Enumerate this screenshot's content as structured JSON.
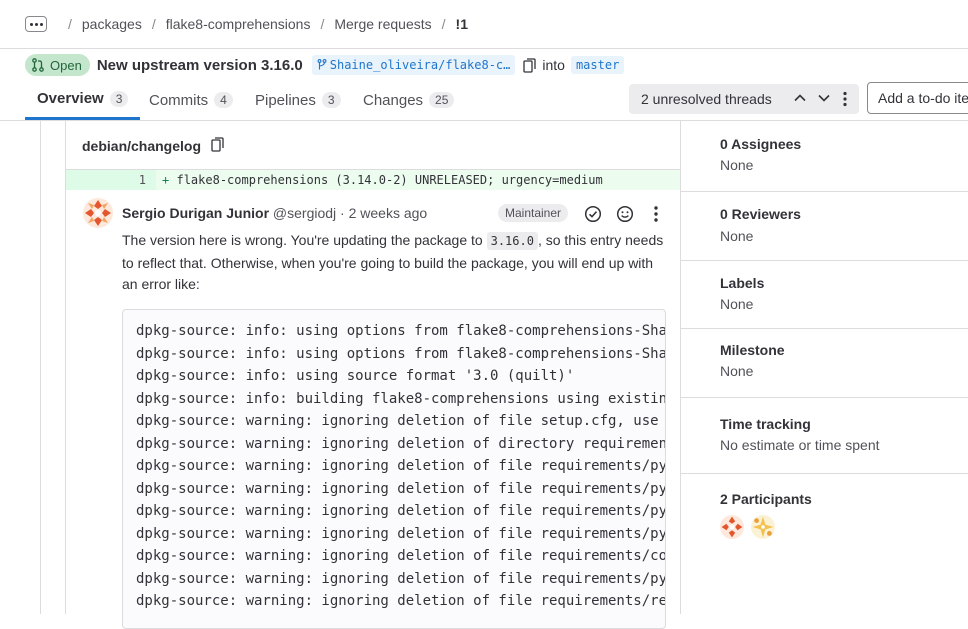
{
  "breadcrumb": {
    "items": [
      "packages",
      "flake8-comprehensions",
      "Merge requests",
      "!1"
    ],
    "separator": "/"
  },
  "mr": {
    "status": "Open",
    "title": "New upstream version 3.16.0",
    "source_branch": "Shaine_oliveira/flake8-c…",
    "into_label": "into",
    "target_branch": "master"
  },
  "tabs": [
    {
      "label": "Overview",
      "count": "3"
    },
    {
      "label": "Commits",
      "count": "4"
    },
    {
      "label": "Pipelines",
      "count": "3"
    },
    {
      "label": "Changes",
      "count": "25"
    }
  ],
  "threads": {
    "label": "2 unresolved threads"
  },
  "todo": {
    "label": "Add a to-do item"
  },
  "diff": {
    "file": "debian/changelog",
    "line_number": "1",
    "line_prefix": "+",
    "line_code": "flake8-comprehensions (3.14.0-2) UNRELEASED; urgency=medium"
  },
  "comment": {
    "author": "Sergio Durigan Junior",
    "handle": "@sergiodj",
    "separator": "·",
    "time": "2 weeks ago",
    "role": "Maintainer",
    "text_a": "The version here is wrong. You're updating the package to ",
    "version_code": "3.16.0",
    "text_b": ", so this entry needs to reflect that. Otherwise, when you're going to build the package, you will end up with an error like:",
    "code_lines": [
      "dpkg-source: info: using options from flake8-comprehensions-Sha",
      "dpkg-source: info: using options from flake8-comprehensions-Sha",
      "dpkg-source: info: using source format '3.0 (quilt)'",
      "dpkg-source: info: building flake8-comprehensions using existin",
      "dpkg-source: warning: ignoring deletion of file setup.cfg, use",
      "dpkg-source: warning: ignoring deletion of directory requiremen",
      "dpkg-source: warning: ignoring deletion of file requirements/py",
      "dpkg-source: warning: ignoring deletion of file requirements/py",
      "dpkg-source: warning: ignoring deletion of file requirements/py",
      "dpkg-source: warning: ignoring deletion of file requirements/py",
      "dpkg-source: warning: ignoring deletion of file requirements/co",
      "dpkg-source: warning: ignoring deletion of file requirements/py",
      "dpkg-source: warning: ignoring deletion of file requirements/re"
    ]
  },
  "sidebar": {
    "assignees": {
      "title": "0 Assignees",
      "value": "None"
    },
    "reviewers": {
      "title": "0 Reviewers",
      "value": "None"
    },
    "labels": {
      "title": "Labels",
      "value": "None"
    },
    "milestone": {
      "title": "Milestone",
      "value": "None"
    },
    "time_tracking": {
      "title": "Time tracking",
      "value": "No estimate or time spent"
    },
    "participants": {
      "title": "2 Participants"
    }
  },
  "colors": {
    "link_blue": "#1f75cb",
    "open_badge_bg": "#c3e6cd",
    "open_badge_text": "#24663b",
    "diff_add_bg": "#ecfdf0",
    "border": "#dcdcde"
  }
}
